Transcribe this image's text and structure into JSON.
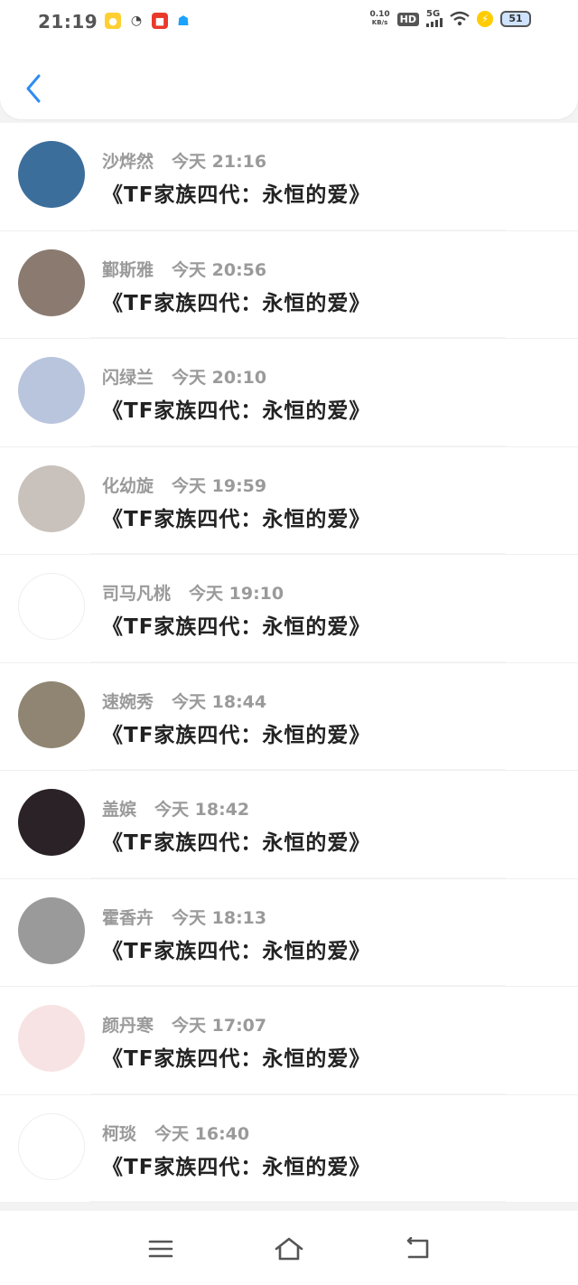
{
  "status_bar": {
    "time": "21:19",
    "net_speed_value": "0.10",
    "net_speed_unit": "KB/s",
    "hd_label": "HD",
    "signal_label": "5G",
    "battery": "51",
    "apps": [
      "qq-pet-icon",
      "wechat-icon",
      "news-app-icon",
      "qq-icon"
    ]
  },
  "header": {
    "back_icon": "chevron-left-icon"
  },
  "messages": [
    {
      "name": "沙烨然",
      "time": "今天 21:16",
      "text": "《TF家族四代：永恒的爱》",
      "avatar": "#3c6e9c"
    },
    {
      "name": "鄞斯雅",
      "time": "今天 20:56",
      "text": "《TF家族四代：永恒的爱》",
      "avatar": "#8a7a70"
    },
    {
      "name": "闪绿兰",
      "time": "今天 20:10",
      "text": "《TF家族四代：永恒的爱》",
      "avatar": "#b9c4dd"
    },
    {
      "name": "化幼旋",
      "time": "今天 19:59",
      "text": "《TF家族四代：永恒的爱》",
      "avatar": "#c9c2bc"
    },
    {
      "name": "司马凡桃",
      "time": "今天 19:10",
      "text": "《TF家族四代：永恒的爱》",
      "avatar": "#ffffff"
    },
    {
      "name": "速婉秀",
      "time": "今天 18:44",
      "text": "《TF家族四代：永恒的爱》",
      "avatar": "#8f8572"
    },
    {
      "name": "盖嫔",
      "time": "今天 18:42",
      "text": "《TF家族四代：永恒的爱》",
      "avatar": "#2a2226"
    },
    {
      "name": "霍香卉",
      "time": "今天 18:13",
      "text": "《TF家族四代：永恒的爱》",
      "avatar": "#9a9a9a"
    },
    {
      "name": "颜丹寒",
      "time": "今天 17:07",
      "text": "《TF家族四代：永恒的爱》",
      "avatar": "#f7e3e3"
    },
    {
      "name": "柯琰",
      "time": "今天 16:40",
      "text": "《TF家族四代：永恒的爱》",
      "avatar": "#ffffff"
    }
  ],
  "navbar": {
    "items": [
      "menu-icon",
      "home-icon",
      "back-icon"
    ]
  },
  "colors": {
    "accent": "#2d8cf0",
    "name_gray": "#9a9a9a",
    "text": "#222222"
  }
}
